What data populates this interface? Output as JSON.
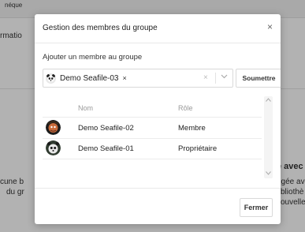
{
  "background": {
    "topbar_text": "néque",
    "left_text_1": "rmatio",
    "left_text_2": "cune b",
    "left_text_3": "du gr",
    "right_bold": "e avec",
    "right_text_1": "ogée ave",
    "right_text_2": "bliothè",
    "right_text_3": "ouvelle"
  },
  "modal": {
    "title": "Gestion des membres du groupe",
    "close_symbol": "×",
    "subtitle": "Ajouter un membre au groupe",
    "select": {
      "selected_tag": "Demo Seafile-03",
      "tag_remove": "×",
      "clear_symbol": "×",
      "arrow_symbol": "⌵"
    },
    "submit_label": "Soumettre",
    "table": {
      "headers": {
        "name": "Nom",
        "role": "Rôle"
      },
      "rows": [
        {
          "name": "Demo Seafile-02",
          "role": "Membre"
        },
        {
          "name": "Demo Seafile-01",
          "role": "Propriétaire"
        }
      ]
    },
    "footer": {
      "close_label": "Fermer"
    }
  },
  "colors": {
    "overlay": "#000000",
    "avatar_2": "#5a2a1c",
    "avatar_1": "#2f3a2f"
  }
}
